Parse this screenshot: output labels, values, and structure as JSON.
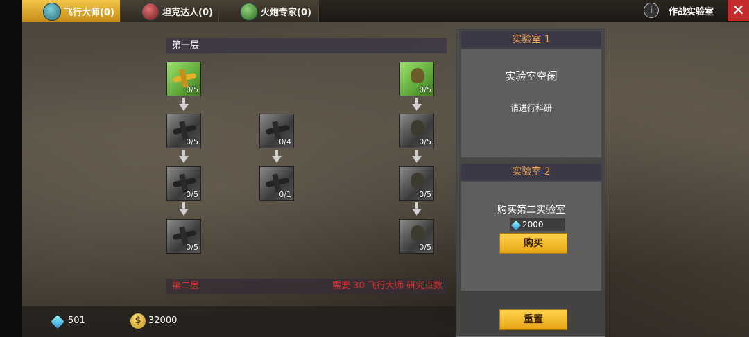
{
  "tabs": [
    {
      "label": "飞行大师(0)",
      "icon": "plane-icon",
      "active": true
    },
    {
      "label": "坦克达人(0)",
      "icon": "tank-icon",
      "active": false
    },
    {
      "label": "火炮专家(0)",
      "icon": "artillery-icon",
      "active": false
    }
  ],
  "header": {
    "info": "i",
    "title": "作战实验室",
    "close": "✕"
  },
  "tree": {
    "layer1": "第一层",
    "layer2": "第二层",
    "layer2_requirement": "需要 30 飞行大师 研究点数",
    "col1": [
      "0/5",
      "0/5",
      "0/5",
      "0/5"
    ],
    "col2": [
      "0/4",
      "0/1"
    ],
    "col3": [
      "0/5",
      "0/5",
      "0/5",
      "0/5"
    ]
  },
  "labs": {
    "lab1": {
      "title": "实验室 1",
      "status": "实验室空闲",
      "hint": "请进行科研"
    },
    "lab2": {
      "title": "实验室 2",
      "buy_text": "购买第二实验室",
      "price": "2000",
      "buy_button": "购买"
    },
    "reset_button": "重置"
  },
  "currency": {
    "gems": "501",
    "gold": "32000",
    "gold_symbol": "$"
  },
  "colors": {
    "accent": "#f3c64a",
    "lab_header_text": "#f0a64a",
    "requirement_red": "#e0302a",
    "close_red": "#c62b2b"
  }
}
